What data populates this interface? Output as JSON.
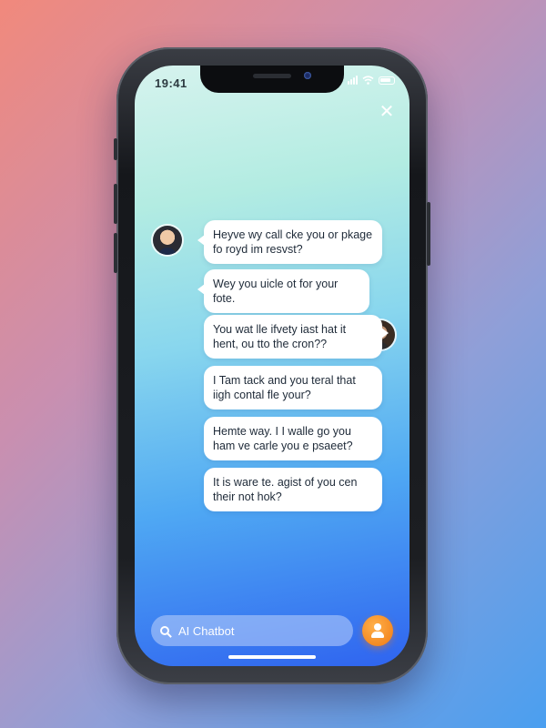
{
  "status_bar": {
    "time": "19:41"
  },
  "messages": [
    {
      "id": 1,
      "sender": "user",
      "text": "Heyve wy call cke you or pkage fo royd im resvst?"
    },
    {
      "id": 2,
      "sender": "user",
      "text": "Wey you uicle ot for your fote."
    },
    {
      "id": 3,
      "sender": "bot",
      "text": "You wat lle ifvety iast hat it hent, ou tto the cron??"
    },
    {
      "id": 4,
      "sender": "user",
      "text": "I Tam tack and you teral that iigh contal fle your?"
    },
    {
      "id": 5,
      "sender": "user",
      "text": "Hemte way. I I walle go you ham ve carle you e psaeet?"
    },
    {
      "id": 6,
      "sender": "user",
      "text": "It is ware te. agist of you cen their not hok?"
    }
  ],
  "composer": {
    "placeholder": "AI Chatbot"
  },
  "colors": {
    "accent": "#f07a12",
    "bubble": "#ffffff"
  },
  "icons": {
    "close": "close-icon",
    "search": "search-icon",
    "send": "user-avatar-button-icon"
  }
}
